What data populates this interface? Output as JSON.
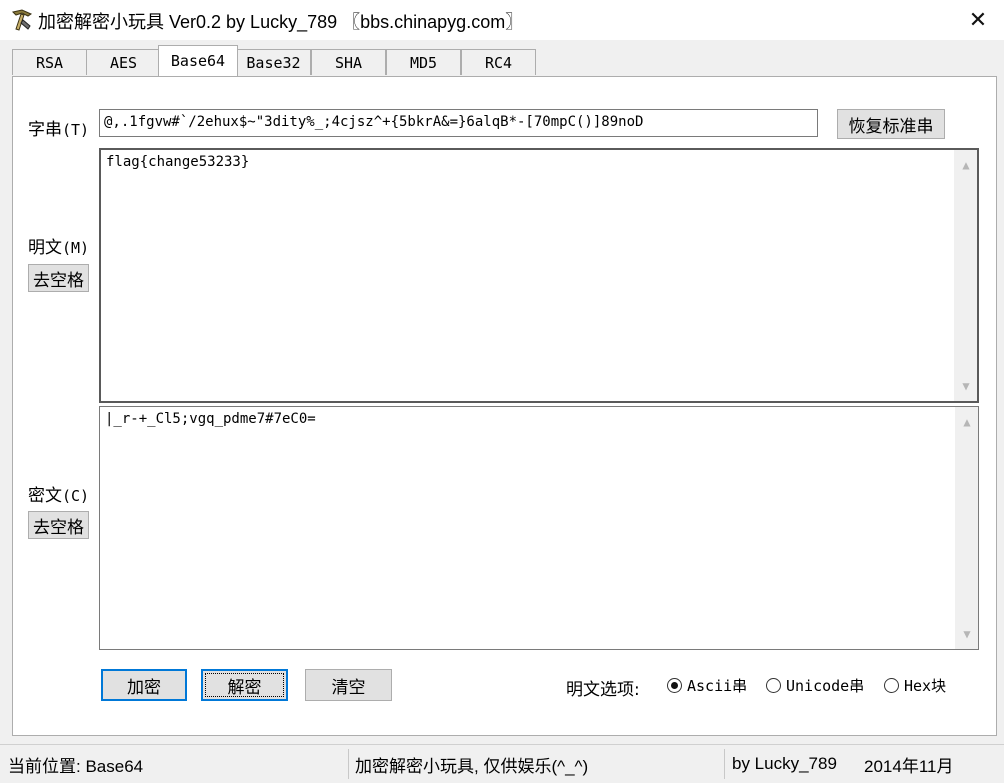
{
  "window": {
    "title": "加密解密小玩具 Ver0.2 by Lucky_789 〖bbs.chinapyg.com〗",
    "icon": "pickaxe-app-icon",
    "close_glyph": "✕"
  },
  "tabs": [
    {
      "label": "RSA",
      "active": false
    },
    {
      "label": "AES",
      "active": false
    },
    {
      "label": "Base64",
      "active": true
    },
    {
      "label": "Base32",
      "active": false
    },
    {
      "label": "SHA",
      "active": false
    },
    {
      "label": "MD5",
      "active": false
    },
    {
      "label": "RC4",
      "active": false
    }
  ],
  "key": {
    "label": "字串",
    "hotkey": "(T)",
    "value": "@,.1fgvw#`/2ehux$~\"3dity%_;4cjsz^+{5bkrA&=}6alqB*-[70mpC()]89noD",
    "restore_button": "恢复标准串"
  },
  "plaintext": {
    "label": "明文",
    "hotkey": "(M)",
    "strip_button": "去空格",
    "value": "flag{change53233}"
  },
  "ciphertext": {
    "label": "密文",
    "hotkey": "(C)",
    "strip_button": "去空格",
    "value": "|_r-+_Cl5;vgq_pdme7#7eC0="
  },
  "actions": {
    "encrypt": "加密",
    "decrypt": "解密",
    "clear": "清空"
  },
  "options": {
    "label": "明文选项:",
    "choices": [
      {
        "label": "Ascii串",
        "checked": true
      },
      {
        "label": "Unicode串",
        "checked": false
      },
      {
        "label": "Hex块",
        "checked": false
      }
    ]
  },
  "status": {
    "position": "当前位置: Base64",
    "note": "加密解密小玩具, 仅供娱乐(^_^)",
    "author": "by Lucky_789",
    "date": "2014年11月"
  },
  "scroll_icons": {
    "up": "▲",
    "down": "▼"
  }
}
